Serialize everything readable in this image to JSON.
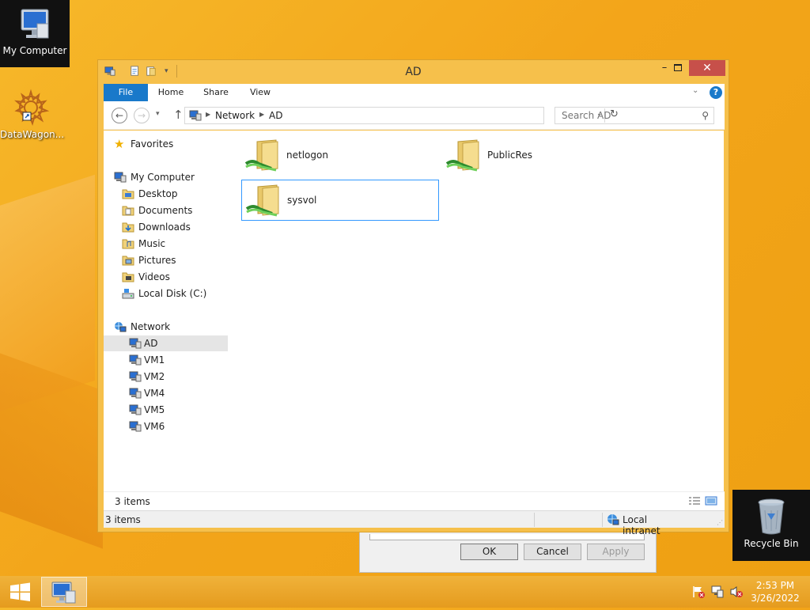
{
  "desktop": {
    "icons": [
      {
        "label": "My Computer"
      },
      {
        "label": "DataWagon..."
      },
      {
        "label": "Recycle Bin"
      }
    ]
  },
  "window": {
    "title": "AD",
    "ribbon_tabs": [
      "File",
      "Home",
      "Share",
      "View"
    ],
    "address": {
      "crumbs": [
        "Network",
        "AD"
      ]
    },
    "search": {
      "placeholder": "Search AD"
    },
    "nav": {
      "favorites": "Favorites",
      "my_computer": "My Computer",
      "computer_items": [
        "Desktop",
        "Documents",
        "Downloads",
        "Music",
        "Pictures",
        "Videos",
        "Local Disk (C:)"
      ],
      "network": "Network",
      "network_items": [
        "AD",
        "VM1",
        "VM2",
        "VM4",
        "VM5",
        "VM6"
      ],
      "selected": "AD"
    },
    "items": [
      {
        "name": "netlogon",
        "icon": "shared-folder-icon"
      },
      {
        "name": "PublicRes",
        "icon": "shared-folder-icon"
      },
      {
        "name": "sysvol",
        "icon": "shared-folder-icon",
        "selected": true
      }
    ],
    "inner_status": "3 items",
    "status": {
      "count": "3 items",
      "zone": "Local intranet"
    }
  },
  "background_dialog": {
    "buttons": [
      "OK",
      "Cancel",
      "Apply"
    ]
  },
  "taskbar": {
    "time": "2:53 PM",
    "date": "3/26/2022"
  },
  "colors": {
    "accent": "#1979ca",
    "desktop": "#f3a51a",
    "selection": "#3399ff",
    "close": "#c7504a"
  }
}
